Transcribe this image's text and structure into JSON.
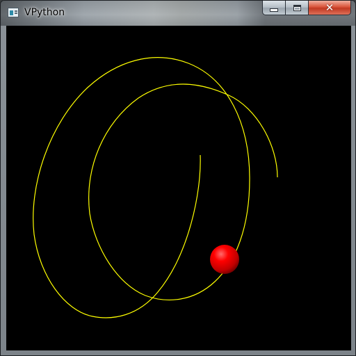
{
  "window": {
    "title": "VPython"
  },
  "controls": {
    "minimize": "minimize",
    "maximize": "maximize",
    "close": "close"
  },
  "scene": {
    "background_color": "#000000",
    "trail_color": "#ffff00",
    "ball_color": "#ff0000"
  },
  "icons": {
    "app": "vpython-app-icon",
    "minimize": "minimize-icon",
    "maximize": "maximize-icon",
    "close": "close-icon"
  }
}
